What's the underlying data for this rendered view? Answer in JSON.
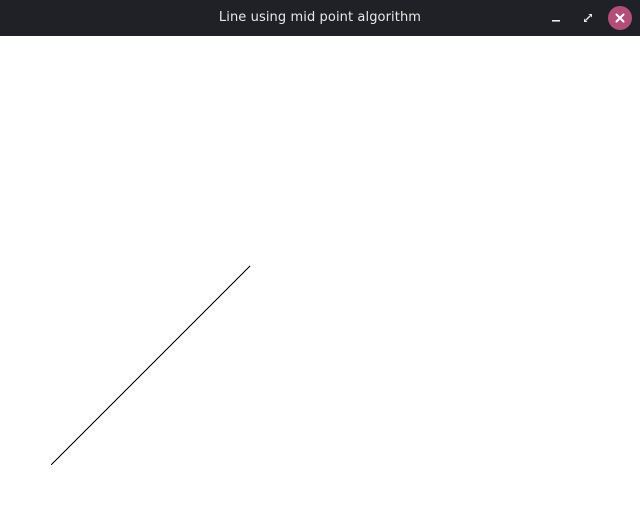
{
  "window": {
    "title": "Line using mid point algorithm"
  },
  "controls": {
    "minimize_icon": "minimize-icon",
    "maximize_icon": "maximize-icon",
    "close_icon": "close-icon",
    "close_color": "#b24f78"
  },
  "canvas": {
    "background": "#ffffff",
    "line_color": "#000000"
  }
}
